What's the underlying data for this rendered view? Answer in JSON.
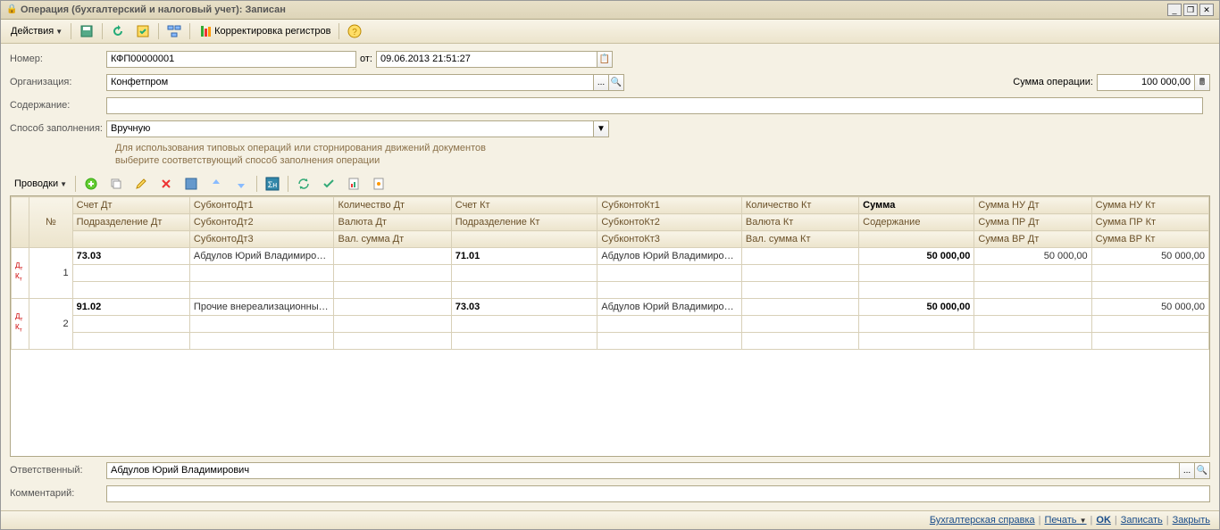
{
  "window": {
    "title": "Операция (бухгалтерский и налоговый учет): Записан"
  },
  "toolbar": {
    "actions": "Действия",
    "registers": "Корректировка регистров"
  },
  "form": {
    "number_label": "Номер:",
    "number": "КФП00000001",
    "from_label": "от:",
    "date": "09.06.2013 21:51:27",
    "org_label": "Организация:",
    "org": "Конфетпром",
    "content_label": "Содержание:",
    "content": "",
    "method_label": "Способ заполнения:",
    "method": "Вручную",
    "hint1": "Для использования типовых операций или сторнирования движений документов",
    "hint2": "выберите соответствующий способ заполнения операции",
    "sum_label": "Сумма операции:",
    "sum": "100 000,00",
    "entries_label": "Проводки",
    "resp_label": "Ответственный:",
    "resp": "Абдулов Юрий Владимирович",
    "comment_label": "Комментарий:",
    "comment": ""
  },
  "grid": {
    "headers": {
      "num": "№",
      "acc_dt": "Счет Дт",
      "dept_dt": "Подразделение Дт",
      "sub_dt1": "СубконтоДт1",
      "sub_dt2": "СубконтоДт2",
      "sub_dt3": "СубконтоДт3",
      "qty_dt": "Количество Дт",
      "cur_dt": "Валюта Дт",
      "cursum_dt": "Вал. сумма Дт",
      "acc_kt": "Счет Кт",
      "dept_kt": "Подразделение Кт",
      "sub_kt1": "СубконтоКт1",
      "sub_kt2": "СубконтоКт2",
      "sub_kt3": "СубконтоКт3",
      "qty_kt": "Количество Кт",
      "cur_kt": "Валюта Кт",
      "cursum_kt": "Вал. сумма Кт",
      "sum": "Сумма",
      "content": "Содержание",
      "nu_dt": "Сумма НУ Дт",
      "pr_dt": "Сумма ПР Дт",
      "vr_dt": "Сумма ВР Дт",
      "nu_kt": "Сумма НУ Кт",
      "pr_kt": "Сумма ПР Кт",
      "vr_kt": "Сумма ВР Кт"
    },
    "rows": [
      {
        "n": "1",
        "acc_dt": "73.03",
        "sub_dt1": "Абдулов Юрий Владимирович",
        "acc_kt": "71.01",
        "sub_kt1": "Абдулов Юрий Владимирович",
        "sum": "50 000,00",
        "nu_dt": "50 000,00",
        "nu_kt": "50 000,00"
      },
      {
        "n": "2",
        "acc_dt": "91.02",
        "sub_dt1": "Прочие внереализационные...",
        "acc_kt": "73.03",
        "sub_kt1": "Абдулов Юрий Владимирович",
        "sum": "50 000,00",
        "nu_dt": "",
        "nu_kt": "50 000,00"
      }
    ]
  },
  "footer": {
    "ref": "Бухгалтерская справка",
    "print": "Печать",
    "ok": "OK",
    "save": "Записать",
    "close": "Закрыть"
  }
}
